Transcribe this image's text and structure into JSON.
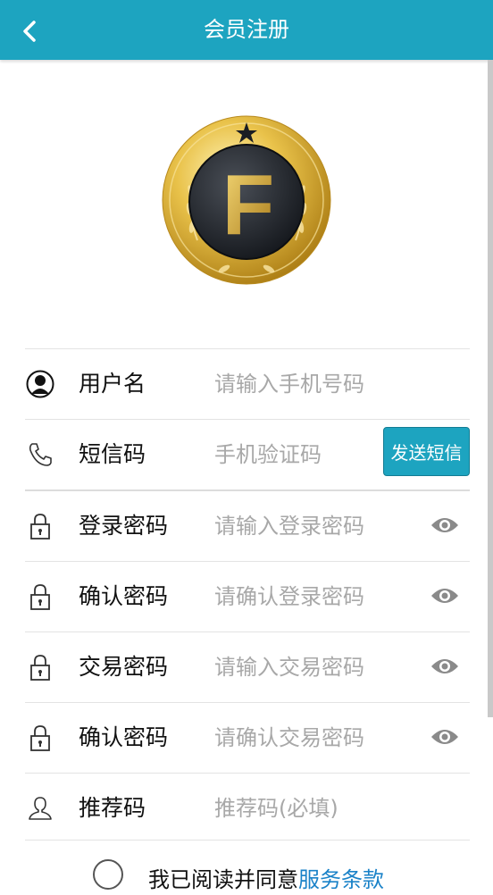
{
  "header": {
    "title": "会员注册"
  },
  "logo": {
    "letter": "F"
  },
  "form": {
    "username": {
      "label": "用户名",
      "placeholder": "请输入手机号码"
    },
    "sms": {
      "label": "短信码",
      "placeholder": "手机验证码",
      "button": "发送短信"
    },
    "login_password": {
      "label": "登录密码",
      "placeholder": "请输入登录密码"
    },
    "confirm_login_password": {
      "label": "确认密码",
      "placeholder": "请确认登录密码"
    },
    "trade_password": {
      "label": "交易密码",
      "placeholder": "请输入交易密码"
    },
    "confirm_trade_password": {
      "label": "确认密码",
      "placeholder": "请确认交易密码"
    },
    "referral": {
      "label": "推荐码",
      "placeholder": "推荐码(必填)"
    }
  },
  "agreement": {
    "text": "我已阅读并同意",
    "link": "服务条款"
  },
  "colors": {
    "primary": "#1da4c0",
    "link": "#1a82c8"
  }
}
